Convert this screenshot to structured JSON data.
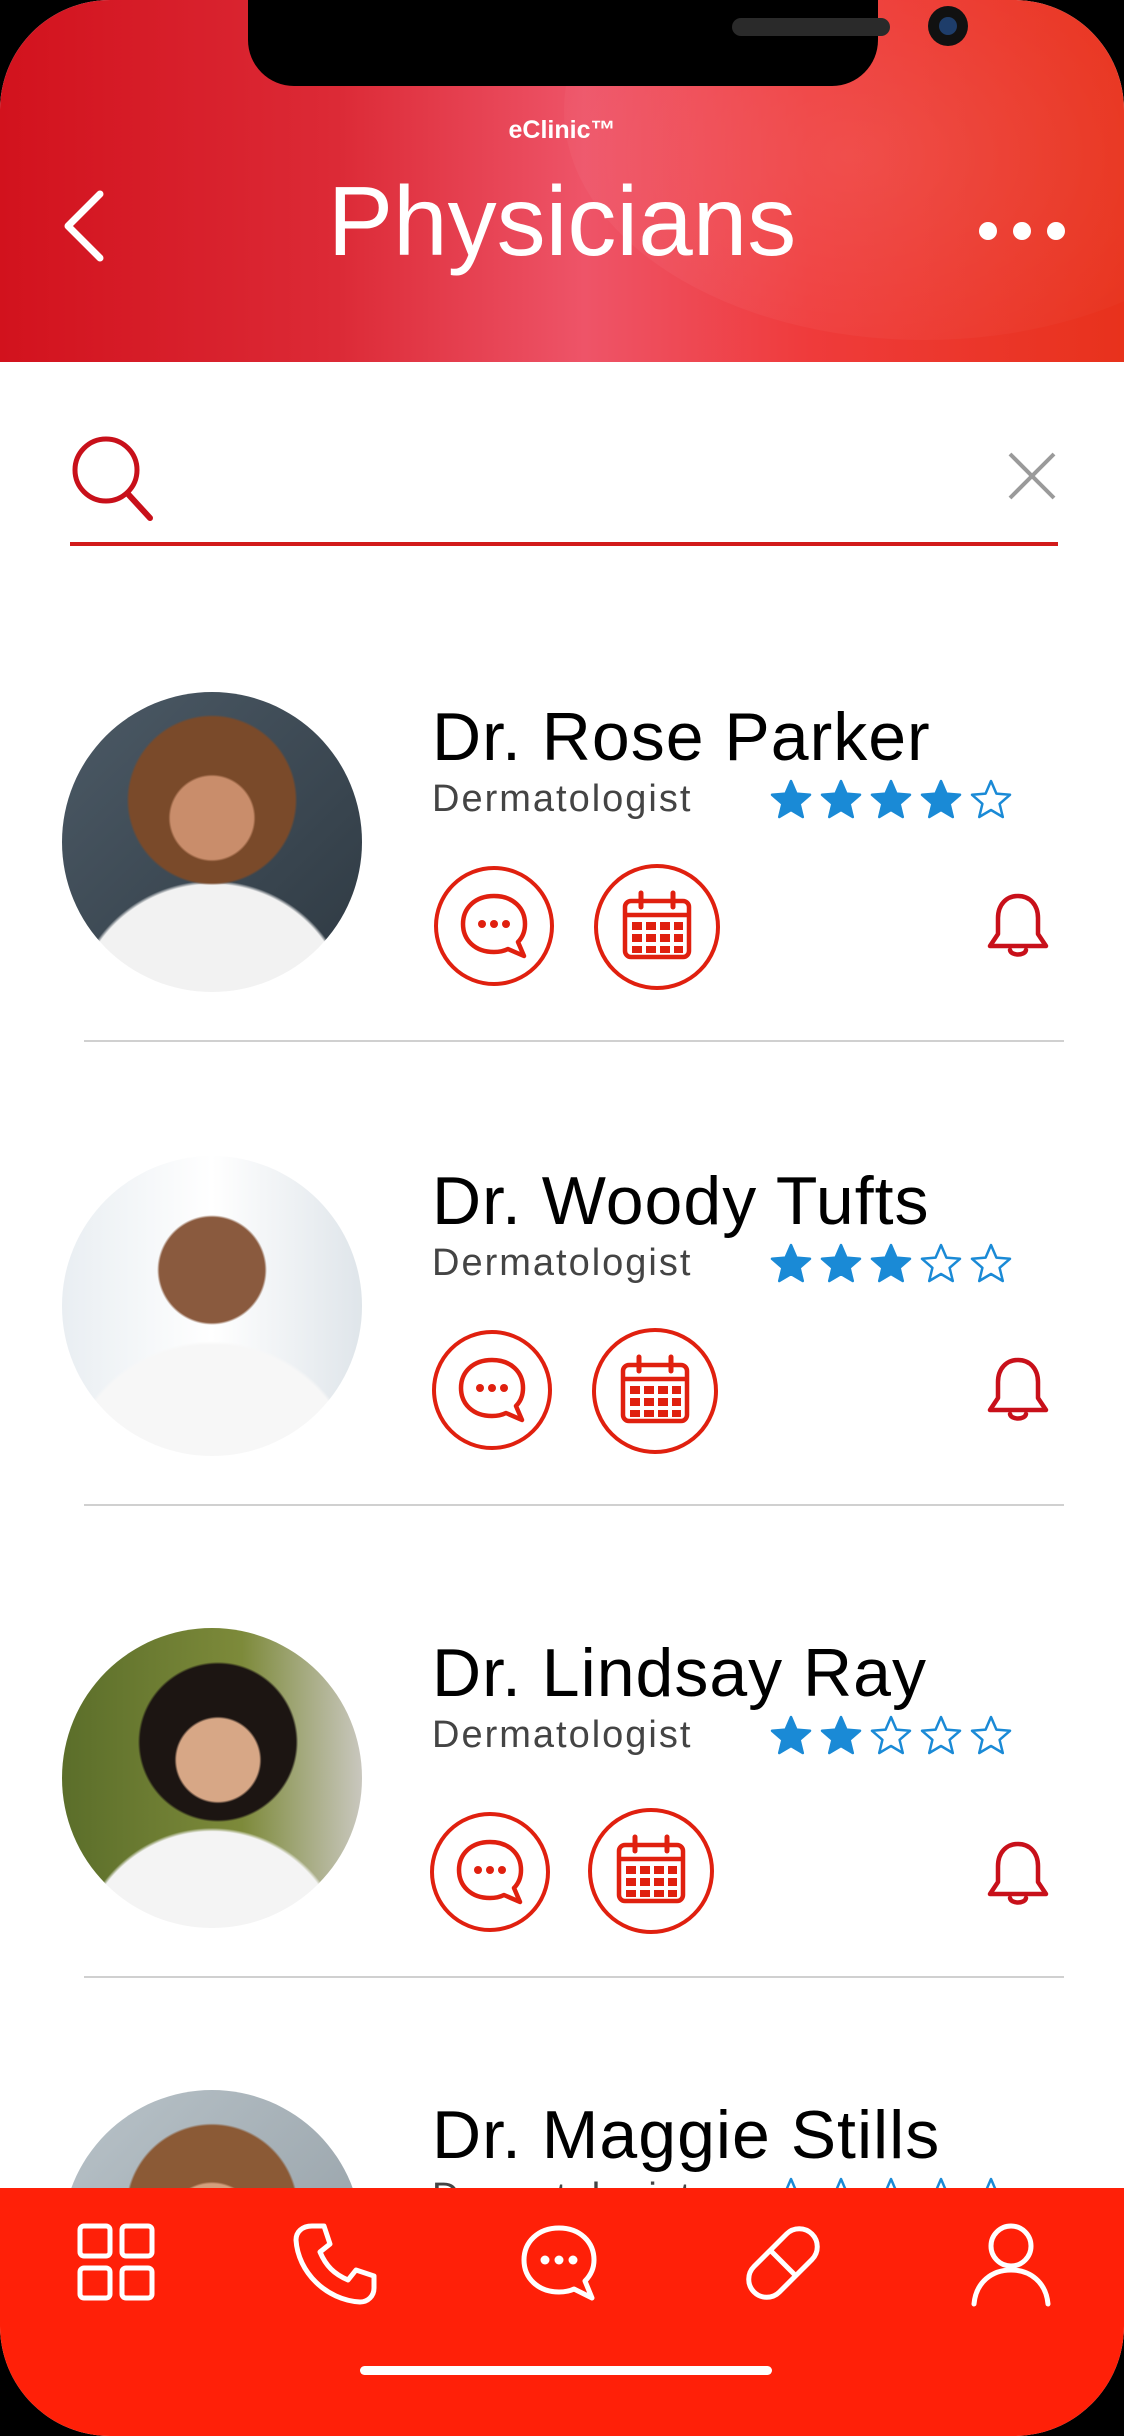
{
  "app": {
    "brand": "eClinic™",
    "title": "Physicians"
  },
  "colors": {
    "accent": "#e0200f",
    "star": "#1a8ad6",
    "tabbar": "#ff2008"
  },
  "search": {
    "value": "",
    "placeholder": ""
  },
  "physicians": [
    {
      "name": "Dr. Rose Parker",
      "specialty": "Dermatologist",
      "rating": 4,
      "rating_max": 5
    },
    {
      "name": "Dr. Woody Tufts",
      "specialty": "Dermatologist",
      "rating": 3,
      "rating_max": 5
    },
    {
      "name": "Dr. Lindsay Ray",
      "specialty": "Dermatologist",
      "rating": 2,
      "rating_max": 5
    },
    {
      "name": "Dr. Maggie Stills",
      "specialty": "Dermatologist",
      "rating": 0,
      "rating_max": 5
    }
  ],
  "icons": {
    "header": [
      "chevron-left-icon",
      "more-dots-icon"
    ],
    "card_actions": [
      "chat-bubble-icon",
      "calendar-icon",
      "bell-icon"
    ],
    "tabs": [
      "grid-icon",
      "phone-icon",
      "chat-icon",
      "pill-icon",
      "user-icon"
    ]
  }
}
